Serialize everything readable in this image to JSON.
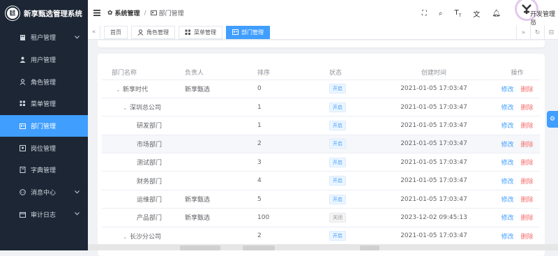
{
  "app": {
    "title": "新享甄选管理系统",
    "logo_text_line1": "新享",
    "logo_text_line2": "甄选"
  },
  "sidebar": {
    "items": [
      {
        "label": "租户管理",
        "icon": "building-icon",
        "has_children": true,
        "active": false
      },
      {
        "label": "用户管理",
        "icon": "user-icon",
        "has_children": false,
        "active": false
      },
      {
        "label": "角色管理",
        "icon": "user-outline-icon",
        "has_children": false,
        "active": false
      },
      {
        "label": "菜单管理",
        "icon": "grid-icon",
        "has_children": false,
        "active": false
      },
      {
        "label": "部门管理",
        "icon": "id-card-icon",
        "has_children": false,
        "active": true
      },
      {
        "label": "岗位管理",
        "icon": "post-icon",
        "has_children": false,
        "active": false
      },
      {
        "label": "字典管理",
        "icon": "book-icon",
        "has_children": false,
        "active": false
      },
      {
        "label": "消息中心",
        "icon": "chat-icon",
        "has_children": true,
        "active": false
      },
      {
        "label": "审计日志",
        "icon": "calendar-icon",
        "has_children": true,
        "active": false
      }
    ]
  },
  "header": {
    "breadcrumb_1": "系统管理",
    "breadcrumb_2": "部门管理",
    "username": "开发管理员",
    "separator": "/"
  },
  "tags": [
    {
      "label": "首页",
      "icon": "",
      "active": false
    },
    {
      "label": "角色管理",
      "icon": "user-outline-icon",
      "active": false
    },
    {
      "label": "菜单管理",
      "icon": "grid-icon",
      "active": false
    },
    {
      "label": "部门管理",
      "icon": "id-card-icon",
      "active": true
    }
  ],
  "table": {
    "headers": {
      "name": "部门名称",
      "leader": "负责人",
      "sort": "排序",
      "status": "状态",
      "created": "创建时间",
      "actions": "操作"
    },
    "edit_label": "修改",
    "delete_label": "删除",
    "rows": [
      {
        "name": "新享时代",
        "leader": "新享甄选",
        "sort": "0",
        "status": "开启",
        "created": "2021-01-05 17:03:47",
        "level": 0,
        "expand": "down"
      },
      {
        "name": "深圳总公司",
        "leader": "",
        "sort": "1",
        "status": "开启",
        "created": "2021-01-05 17:03:47",
        "level": 1,
        "expand": "down"
      },
      {
        "name": "研发部门",
        "leader": "",
        "sort": "1",
        "status": "开启",
        "created": "2021-01-05 17:03:47",
        "level": 2,
        "expand": ""
      },
      {
        "name": "市场部门",
        "leader": "",
        "sort": "2",
        "status": "开启",
        "created": "2021-01-05 17:03:47",
        "level": 2,
        "expand": "",
        "highlight": true
      },
      {
        "name": "测试部门",
        "leader": "",
        "sort": "3",
        "status": "开启",
        "created": "2021-01-05 17:03:47",
        "level": 2,
        "expand": ""
      },
      {
        "name": "财务部门",
        "leader": "",
        "sort": "4",
        "status": "开启",
        "created": "2021-01-05 17:03:47",
        "level": 2,
        "expand": ""
      },
      {
        "name": "运维部门",
        "leader": "新享甄选",
        "sort": "5",
        "status": "开启",
        "created": "2021-01-05 17:03:47",
        "level": 2,
        "expand": ""
      },
      {
        "name": "产品部门",
        "leader": "新享甄选",
        "sort": "100",
        "status": "关闭",
        "created": "2023-12-02 09:45:13",
        "level": 2,
        "expand": ""
      },
      {
        "name": "长沙分公司",
        "leader": "",
        "sort": "2",
        "status": "开启",
        "created": "2021-01-05 17:03:47",
        "level": 1,
        "expand": "down"
      }
    ]
  },
  "colors": {
    "sidebar_bg": "#1c2634",
    "accent": "#409eff",
    "danger": "#f56c6c"
  }
}
